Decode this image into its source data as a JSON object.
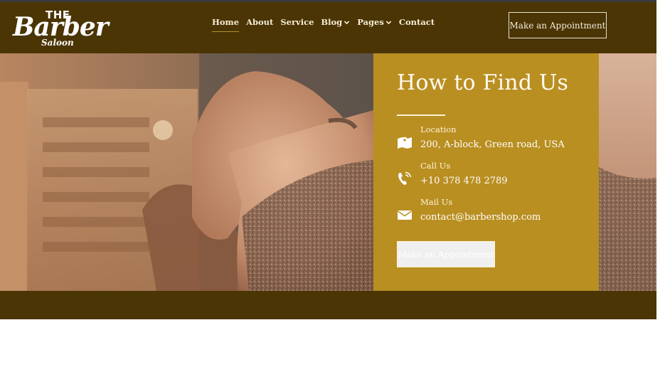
{
  "brand": {
    "line1": "THE",
    "line2": "Barber",
    "line3": "Saloon"
  },
  "nav": {
    "items": [
      {
        "label": "Home"
      },
      {
        "label": "About"
      },
      {
        "label": "Service"
      },
      {
        "label": "Blog"
      },
      {
        "label": "Pages"
      },
      {
        "label": "Contact"
      }
    ],
    "cta": "Make an Appointment"
  },
  "find_us": {
    "title": "How to Find Us",
    "location": {
      "label": "Location",
      "value": "200, A-block, Green road, USA",
      "icon": "map-icon"
    },
    "call": {
      "label": "Call Us",
      "value": "+10 378 478 2789",
      "icon": "phone-icon"
    },
    "mail": {
      "label": "Mail Us",
      "value": "contact@barbershop.com",
      "icon": "envelope-icon"
    },
    "cta": "Make an Appointment"
  },
  "colors": {
    "nav_bg": "#4b3505",
    "panel_bg": "#b98f22",
    "accent_underline": "#b8902a"
  }
}
